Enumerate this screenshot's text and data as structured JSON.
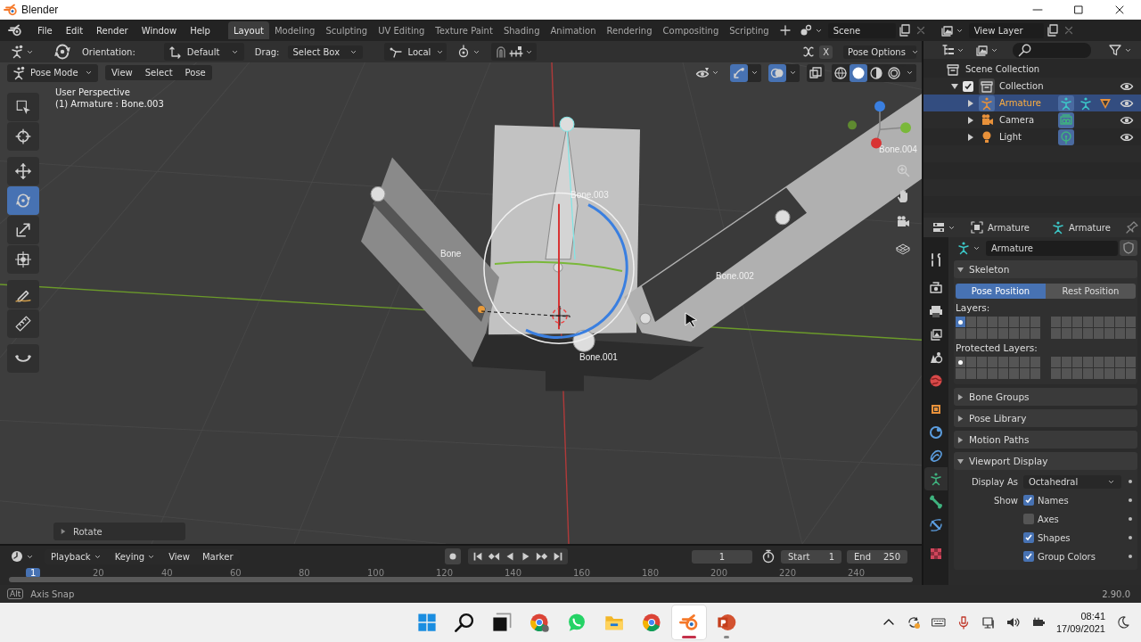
{
  "window": {
    "title": "Blender"
  },
  "menu": [
    "File",
    "Edit",
    "Render",
    "Window",
    "Help"
  ],
  "workspaces": [
    {
      "label": "Layout",
      "selected": true
    },
    {
      "label": "Modeling",
      "selected": false
    },
    {
      "label": "Sculpting",
      "selected": false
    },
    {
      "label": "UV Editing",
      "selected": false
    },
    {
      "label": "Texture Paint",
      "selected": false
    },
    {
      "label": "Shading",
      "selected": false
    },
    {
      "label": "Animation",
      "selected": false
    },
    {
      "label": "Rendering",
      "selected": false
    },
    {
      "label": "Compositing",
      "selected": false
    },
    {
      "label": "Scripting",
      "selected": false
    }
  ],
  "scene": "Scene",
  "view_layer": "View Layer",
  "tool_settings": {
    "orientation_label": "Orientation:",
    "orientation": "Default",
    "drag_label": "Drag:",
    "drag": "Select Box",
    "pivot": "Local",
    "mirror": "X",
    "pose_options": "Pose Options"
  },
  "viewport_header": {
    "mode": "Pose Mode",
    "menus": [
      "View",
      "Select",
      "Pose"
    ],
    "gizmos": true,
    "overlays": true,
    "shading": [
      {
        "kind": "wireframe",
        "selected": false
      },
      {
        "kind": "solid",
        "selected": true
      },
      {
        "kind": "material",
        "selected": false
      },
      {
        "kind": "rendered",
        "selected": false
      }
    ]
  },
  "toolbar": [
    {
      "kind": "select-box",
      "selected": false
    },
    {
      "kind": "cursor",
      "selected": false
    },
    {
      "kind": "move",
      "selected": false
    },
    {
      "kind": "rotate",
      "selected": true
    },
    {
      "kind": "scale",
      "selected": false
    },
    {
      "kind": "transform",
      "selected": false
    },
    {
      "kind": "annotate",
      "selected": false
    },
    {
      "kind": "measure",
      "selected": false
    },
    {
      "kind": "bend",
      "selected": false
    }
  ],
  "viewport": {
    "perspective": "User Perspective",
    "active": "(1) Armature : Bone.003",
    "bone_labels": [
      "Bone",
      "Bone.003",
      "Bone.002",
      "Bone.001",
      "Bone.004"
    ],
    "last_operator": "Rotate"
  },
  "outliner": {
    "items": [
      {
        "name": "Scene Collection",
        "kind": "scene-collection",
        "selected": false,
        "children": [
          {
            "name": "Collection",
            "kind": "collection",
            "selected": false,
            "checked": true,
            "expanded": true,
            "visible": true,
            "children": [
              {
                "name": "Armature",
                "kind": "armature",
                "selected": true,
                "expanded": false,
                "visible": true
              },
              {
                "name": "Camera",
                "kind": "camera",
                "selected": false,
                "expanded": false,
                "visible": true
              },
              {
                "name": "Light",
                "kind": "light",
                "selected": false,
                "expanded": false,
                "visible": true
              }
            ]
          }
        ]
      }
    ]
  },
  "properties": {
    "object": "Armature",
    "data": "Armature",
    "datablock": "Armature",
    "tabs": [
      {
        "kind": "tool",
        "selected": false
      },
      {
        "kind": "render",
        "selected": false
      },
      {
        "kind": "output",
        "selected": false
      },
      {
        "kind": "view-layer",
        "selected": false
      },
      {
        "kind": "scene",
        "selected": false
      },
      {
        "kind": "world",
        "selected": false
      },
      {
        "kind": "object",
        "selected": false
      },
      {
        "kind": "physics",
        "selected": false
      },
      {
        "kind": "constraints",
        "selected": false
      },
      {
        "kind": "armature",
        "selected": true
      },
      {
        "kind": "bone",
        "selected": false
      },
      {
        "kind": "bone-constraint",
        "selected": false
      },
      {
        "kind": "texture",
        "selected": false
      }
    ],
    "panels": [
      {
        "kind": "skeleton",
        "title": "Skeleton",
        "expanded": true,
        "positions": [
          {
            "label": "Pose Position",
            "selected": true
          },
          {
            "label": "Rest Position",
            "selected": false
          }
        ],
        "layers_label": "Layers:",
        "protected_label": "Protected Layers:",
        "layers": [
          {
            "selected": true,
            "used": true
          },
          {
            "selected": false,
            "used": false
          },
          {
            "selected": false,
            "used": false
          },
          {
            "selected": false,
            "used": false
          },
          {
            "selected": false,
            "used": false
          },
          {
            "selected": false,
            "used": false
          },
          {
            "selected": false,
            "used": false
          },
          {
            "selected": false,
            "used": false
          },
          {
            "selected": false,
            "used": false
          },
          {
            "selected": false,
            "used": false
          },
          {
            "selected": false,
            "used": false
          },
          {
            "selected": false,
            "used": false
          },
          {
            "selected": false,
            "used": false
          },
          {
            "selected": false,
            "used": false
          },
          {
            "selected": false,
            "used": false
          },
          {
            "selected": false,
            "used": false
          },
          {
            "selected": false,
            "used": false
          },
          {
            "selected": false,
            "used": false
          },
          {
            "selected": false,
            "used": false
          },
          {
            "selected": false,
            "used": false
          },
          {
            "selected": false,
            "used": false
          },
          {
            "selected": false,
            "used": false
          },
          {
            "selected": false,
            "used": false
          },
          {
            "selected": false,
            "used": false
          },
          {
            "selected": false,
            "used": false
          },
          {
            "selected": false,
            "used": false
          },
          {
            "selected": false,
            "used": false
          },
          {
            "selected": false,
            "used": false
          },
          {
            "selected": false,
            "used": false
          },
          {
            "selected": false,
            "used": false
          },
          {
            "selected": false,
            "used": false
          },
          {
            "selected": false,
            "used": false
          }
        ],
        "protected_layers": [
          {
            "selected": false,
            "used": true
          },
          {
            "selected": false,
            "used": false
          },
          {
            "selected": false,
            "used": false
          },
          {
            "selected": false,
            "used": false
          },
          {
            "selected": false,
            "used": false
          },
          {
            "selected": false,
            "used": false
          },
          {
            "selected": false,
            "used": false
          },
          {
            "selected": false,
            "used": false
          },
          {
            "selected": false,
            "used": false
          },
          {
            "selected": false,
            "used": false
          },
          {
            "selected": false,
            "used": false
          },
          {
            "selected": false,
            "used": false
          },
          {
            "selected": false,
            "used": false
          },
          {
            "selected": false,
            "used": false
          },
          {
            "selected": false,
            "used": false
          },
          {
            "selected": false,
            "used": false
          },
          {
            "selected": false,
            "used": false
          },
          {
            "selected": false,
            "used": false
          },
          {
            "selected": false,
            "used": false
          },
          {
            "selected": false,
            "used": false
          },
          {
            "selected": false,
            "used": false
          },
          {
            "selected": false,
            "used": false
          },
          {
            "selected": false,
            "used": false
          },
          {
            "selected": false,
            "used": false
          },
          {
            "selected": false,
            "used": false
          },
          {
            "selected": false,
            "used": false
          },
          {
            "selected": false,
            "used": false
          },
          {
            "selected": false,
            "used": false
          },
          {
            "selected": false,
            "used": false
          },
          {
            "selected": false,
            "used": false
          },
          {
            "selected": false,
            "used": false
          },
          {
            "selected": false,
            "used": false
          }
        ]
      },
      {
        "kind": "plain",
        "title": "Bone Groups",
        "expanded": false
      },
      {
        "kind": "plain",
        "title": "Pose Library",
        "expanded": false
      },
      {
        "kind": "plain",
        "title": "Motion Paths",
        "expanded": false
      },
      {
        "kind": "viewport-display",
        "title": "Viewport Display",
        "expanded": true,
        "display_as_label": "Display As",
        "display_as": "Octahedral",
        "show_label": "Show",
        "options": [
          {
            "label": "Names",
            "checked": true
          },
          {
            "label": "Axes",
            "checked": false
          },
          {
            "label": "Shapes",
            "checked": true
          },
          {
            "label": "Group Colors",
            "checked": true
          }
        ]
      }
    ]
  },
  "timeline": {
    "menus": [
      {
        "label": "Playback",
        "kind": "dropdown"
      },
      {
        "label": "Keying",
        "kind": "dropdown"
      },
      {
        "label": "View",
        "kind": "menu"
      },
      {
        "label": "Marker",
        "kind": "menu"
      }
    ],
    "current_frame": "1",
    "start_label": "Start",
    "start": "1",
    "end_label": "End",
    "end": "250",
    "playhead": "1",
    "ruler": [
      "20",
      "40",
      "60",
      "80",
      "100",
      "120",
      "140",
      "160",
      "180",
      "200",
      "220",
      "240"
    ]
  },
  "status_bar": {
    "key": "Alt",
    "hint": "Axis Snap",
    "version": "2.90.0"
  },
  "taskbar": {
    "apps": [
      {
        "kind": "start",
        "running": false,
        "active": false
      },
      {
        "kind": "search",
        "running": false,
        "active": false
      },
      {
        "kind": "task-view",
        "running": false,
        "active": false
      },
      {
        "kind": "chrome-profile",
        "running": false,
        "active": false
      },
      {
        "kind": "whatsapp",
        "running": false,
        "active": false
      },
      {
        "kind": "folder",
        "running": false,
        "active": false
      },
      {
        "kind": "chrome",
        "running": false,
        "active": false
      },
      {
        "kind": "blender",
        "running": true,
        "active": true
      },
      {
        "kind": "powerpoint",
        "running": true,
        "active": false
      }
    ],
    "time": "08:41",
    "date": "17/09/2021"
  }
}
